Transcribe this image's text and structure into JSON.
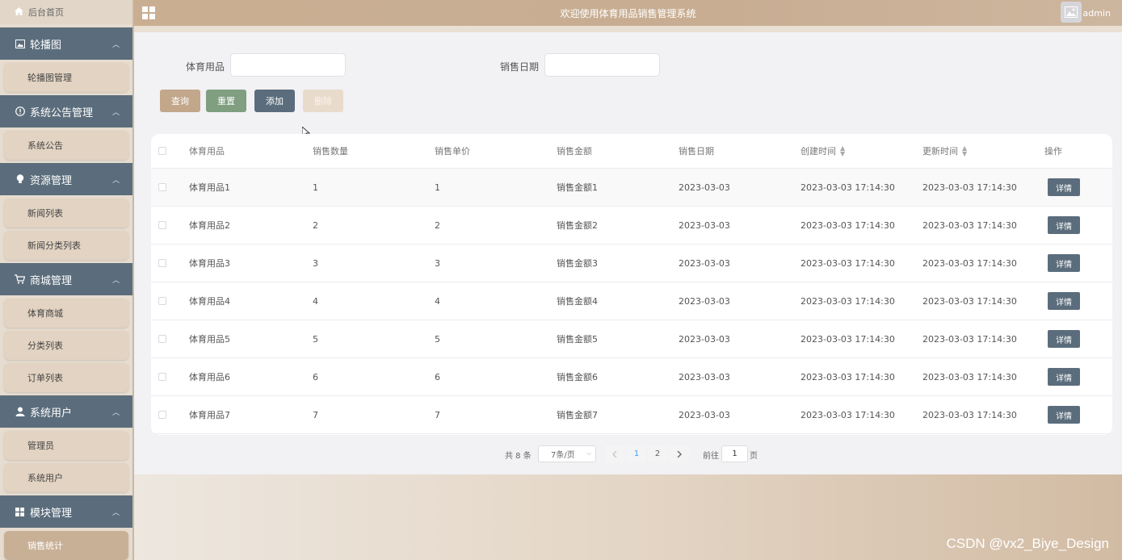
{
  "header": {
    "title": "欢迎使用体育用品销售管理系统",
    "user": "admin"
  },
  "sidebar": {
    "home": "后台首页",
    "groups": [
      {
        "label": "轮播图",
        "icon": "image-icon",
        "items": [
          "轮播图管理"
        ]
      },
      {
        "label": "系统公告管理",
        "icon": "info-icon",
        "items": [
          "系统公告"
        ]
      },
      {
        "label": "资源管理",
        "icon": "bulb-icon",
        "items": [
          "新闻列表",
          "新闻分类列表"
        ]
      },
      {
        "label": "商城管理",
        "icon": "cart-icon",
        "items": [
          "体育商城",
          "分类列表",
          "订单列表"
        ]
      },
      {
        "label": "系统用户",
        "icon": "user-icon",
        "items": [
          "管理员",
          "系统用户"
        ]
      },
      {
        "label": "模块管理",
        "icon": "grid-icon",
        "items": [
          "销售统计"
        ]
      }
    ],
    "active_item": "销售统计"
  },
  "search": {
    "field1_label": "体育用品",
    "field1_value": "",
    "field2_label": "销售日期",
    "field2_value": ""
  },
  "buttons": {
    "query": "查询",
    "reset": "重置",
    "add": "添加",
    "delete": "删除"
  },
  "table": {
    "headers": [
      "体育用品",
      "销售数量",
      "销售单价",
      "销售金额",
      "销售日期",
      "创建时间",
      "更新时间",
      "操作"
    ],
    "detail_label": "详情",
    "rows": [
      [
        "体育用品1",
        "1",
        "1",
        "销售金额1",
        "2023-03-03",
        "2023-03-03 17:14:30",
        "2023-03-03 17:14:30"
      ],
      [
        "体育用品2",
        "2",
        "2",
        "销售金额2",
        "2023-03-03",
        "2023-03-03 17:14:30",
        "2023-03-03 17:14:30"
      ],
      [
        "体育用品3",
        "3",
        "3",
        "销售金额3",
        "2023-03-03",
        "2023-03-03 17:14:30",
        "2023-03-03 17:14:30"
      ],
      [
        "体育用品4",
        "4",
        "4",
        "销售金额4",
        "2023-03-03",
        "2023-03-03 17:14:30",
        "2023-03-03 17:14:30"
      ],
      [
        "体育用品5",
        "5",
        "5",
        "销售金额5",
        "2023-03-03",
        "2023-03-03 17:14:30",
        "2023-03-03 17:14:30"
      ],
      [
        "体育用品6",
        "6",
        "6",
        "销售金额6",
        "2023-03-03",
        "2023-03-03 17:14:30",
        "2023-03-03 17:14:30"
      ],
      [
        "体育用品7",
        "7",
        "7",
        "销售金额7",
        "2023-03-03",
        "2023-03-03 17:14:30",
        "2023-03-03 17:14:30"
      ]
    ]
  },
  "pagination": {
    "total": "共 8 条",
    "page_size": "7条/页",
    "pages": [
      "1",
      "2"
    ],
    "current": "1",
    "goto_label": "前往",
    "goto_value": "1",
    "goto_unit": "页"
  },
  "watermark": "CSDN @vx2_Biye_Design"
}
